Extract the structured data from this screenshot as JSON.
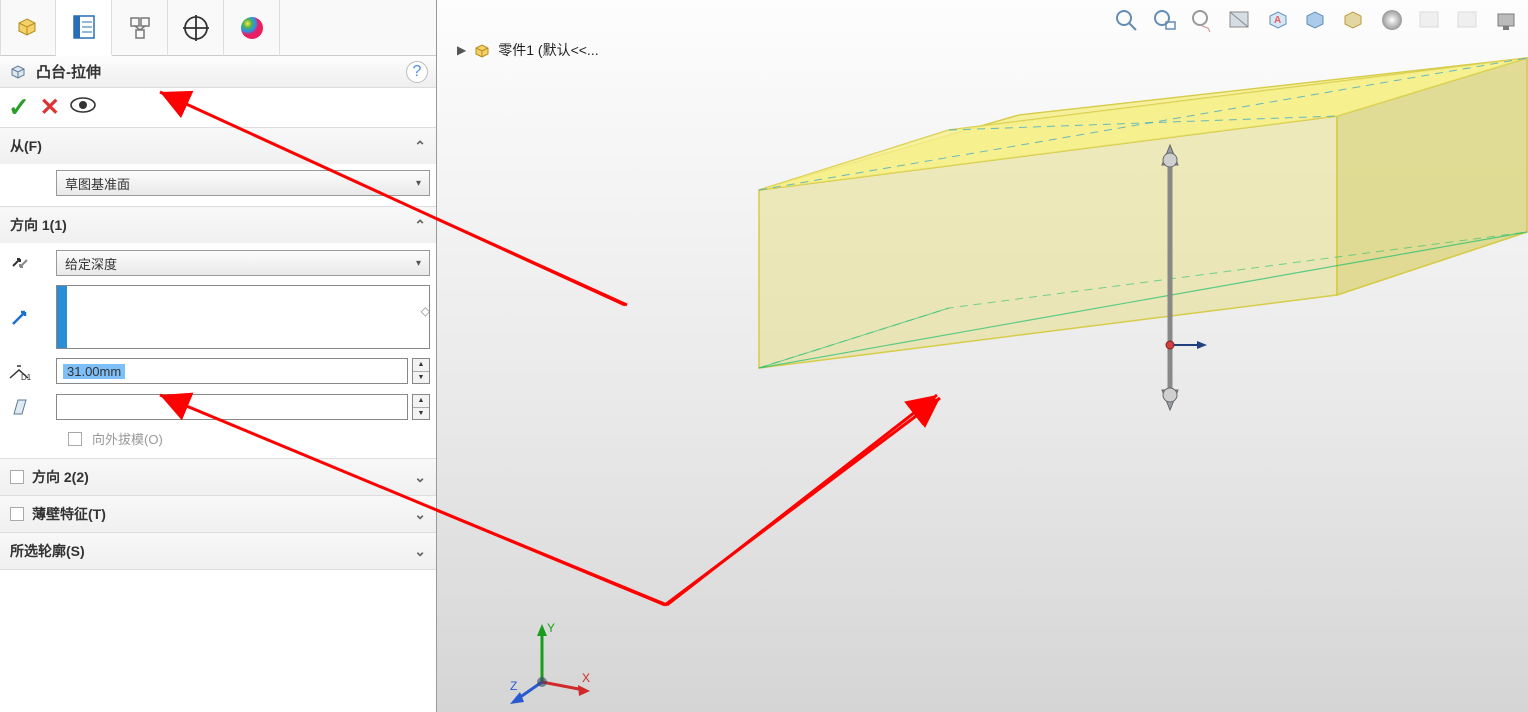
{
  "feature": {
    "title": "凸台-拉伸"
  },
  "breadcrumb": {
    "part_name": "零件1  (默认<<..."
  },
  "sections": {
    "from": {
      "label": "从(F)",
      "value": "草图基准面"
    },
    "dir1": {
      "label": "方向 1(1)",
      "end_condition": "给定深度",
      "depth": "31.00mm",
      "draft_value": "",
      "draft_outward": "向外拔模(O)"
    },
    "dir2": {
      "label": "方向 2(2)"
    },
    "thin": {
      "label": "薄壁特征(T)"
    },
    "contours": {
      "label": "所选轮廓(S)"
    }
  },
  "triad": {
    "x": "X",
    "y": "Y",
    "z": "Z"
  },
  "icons": {
    "help": "?"
  }
}
